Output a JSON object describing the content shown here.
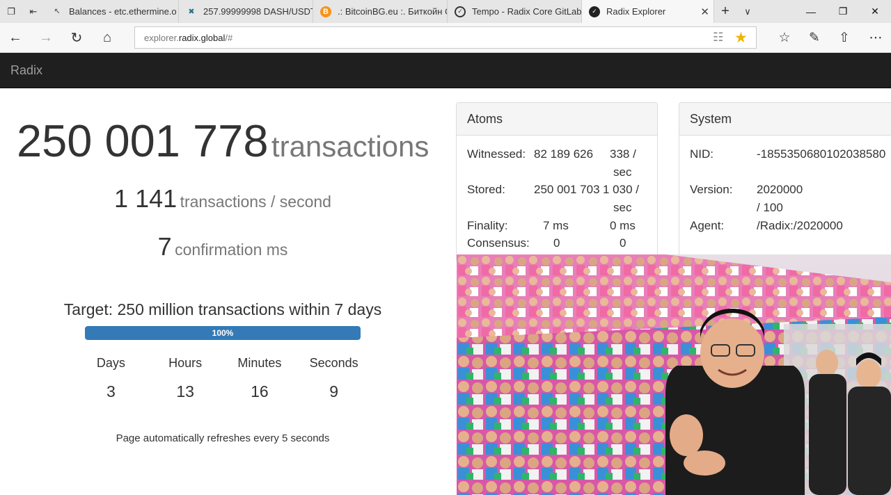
{
  "browser": {
    "tabs": [
      {
        "label": "Balances - etc.ethermine.o",
        "favicon": "ethermine-icon",
        "active": false
      },
      {
        "label": "257.99999998 DASH/USDT",
        "favicon": "exchange-icon",
        "active": false
      },
      {
        "label": ".: BitcoinBG.eu :. Биткойн С",
        "favicon": "bitcoin-icon",
        "active": false
      },
      {
        "label": "Tempo - Radix Core GitLab",
        "favicon": "gitlab-icon",
        "active": false
      },
      {
        "label": "Radix Explorer",
        "favicon": "radix-icon",
        "active": true
      }
    ],
    "address": {
      "prefix": "explorer.",
      "domain": "radix.global",
      "suffix": "/#"
    },
    "colors": {
      "star": "#f0b400",
      "tabstrip": "#e6e6e6"
    }
  },
  "site": {
    "brand": "Radix"
  },
  "stats": {
    "total_transactions": "250 001 778",
    "total_unit": "transactions",
    "tps_value": "1 141",
    "tps_unit": "transactions / second",
    "confirmation_value": "7",
    "confirmation_unit": "confirmation ms",
    "target": "Target: 250 million transactions within 7 days",
    "progress_label": "100%",
    "progress_fraction": 1.0,
    "countdown": [
      {
        "label": "Days",
        "value": "3"
      },
      {
        "label": "Hours",
        "value": "13"
      },
      {
        "label": "Minutes",
        "value": "16"
      },
      {
        "label": "Seconds",
        "value": "9"
      }
    ],
    "refresh_note": "Page automatically refreshes every 5 seconds"
  },
  "atoms": {
    "title": "Atoms",
    "witnessed_label": "Witnessed:",
    "witnessed_value": "82 189 626",
    "witnessed_rate": "338 /",
    "witnessed_rate_unit": "sec",
    "stored_label": "Stored:",
    "stored_value": "250 001 703",
    "stored_rate": "1 030 /",
    "stored_rate_unit": "sec",
    "finality_label": "Finality:",
    "finality_value": "7 ms",
    "finality_rate": "0 ms",
    "consensus_label": "Consensus:",
    "consensus_value": "0",
    "consensus_rate": "0"
  },
  "system": {
    "title": "System",
    "nid_label": "NID:",
    "nid_value": "-1855350680102038580",
    "version_label": "Version:",
    "version_value": "2020000",
    "version_value2": "/ 100",
    "agent_label": "Agent:",
    "agent_value": "/Radix:/2020000"
  }
}
